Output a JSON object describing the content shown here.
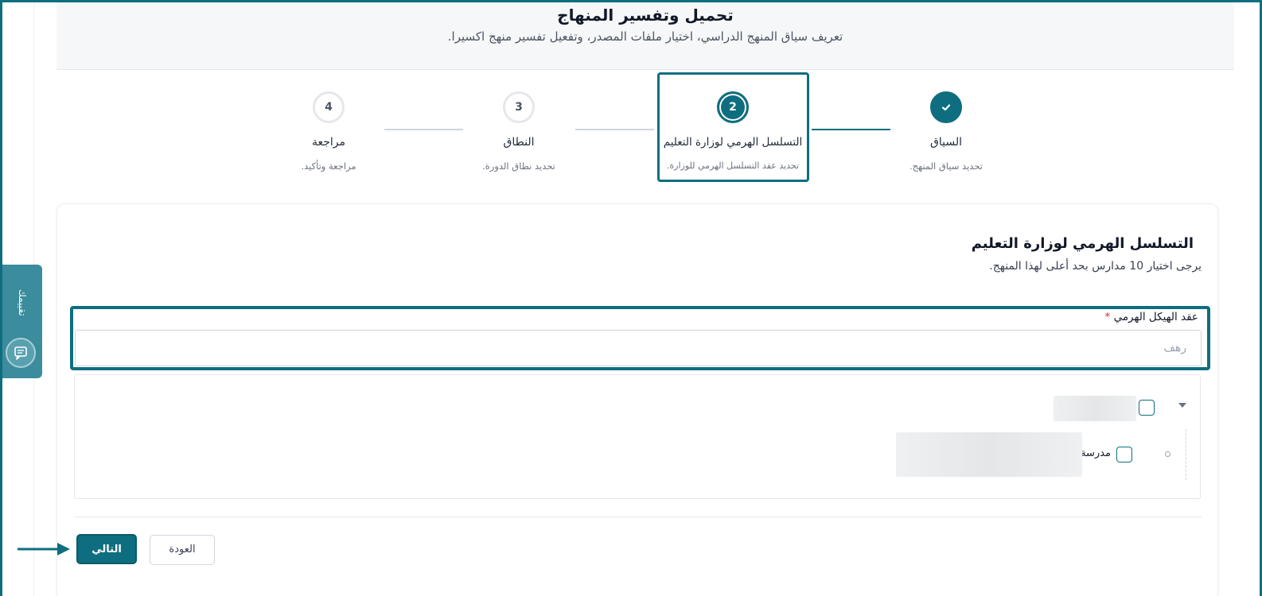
{
  "header": {
    "title": "تحميل وتفسير المنهاج",
    "subtitle": "تعريف سياق المنهج الدراسي، اختيار ملفات المصدر، وتفعيل تفسير منهج اكسيرا."
  },
  "stepper": {
    "steps": [
      {
        "number": "✔",
        "label": "السياق",
        "desc": "تحديد سياق المنهج.",
        "state": "done"
      },
      {
        "number": "2",
        "label": "التسلسل الهرمي لوزارة التعليم",
        "desc": "تحديد عقد التسلسل الهرمي للوزارة.",
        "state": "active"
      },
      {
        "number": "3",
        "label": "النطاق",
        "desc": "تحديد نطاق الدورة.",
        "state": "pending"
      },
      {
        "number": "4",
        "label": "مراجعة",
        "desc": "مراجعة وتأكيد.",
        "state": "pending"
      }
    ]
  },
  "section": {
    "title": "التسلسل الهرمي لوزارة التعليم",
    "description": "يرجى اختيار 10 مدارس بحد أعلى لهذا المنهج."
  },
  "field": {
    "label": "عقد الهيكل الهرمي",
    "required_mark": "*",
    "placeholder": "رهف",
    "value": ""
  },
  "tree": {
    "child_label": "مدرسة"
  },
  "buttons": {
    "next": "التالي",
    "back": "العودة"
  },
  "side_tab": {
    "label": "تقييمك"
  },
  "colors": {
    "accent": "#0e6e80",
    "required": "#dc2626"
  }
}
